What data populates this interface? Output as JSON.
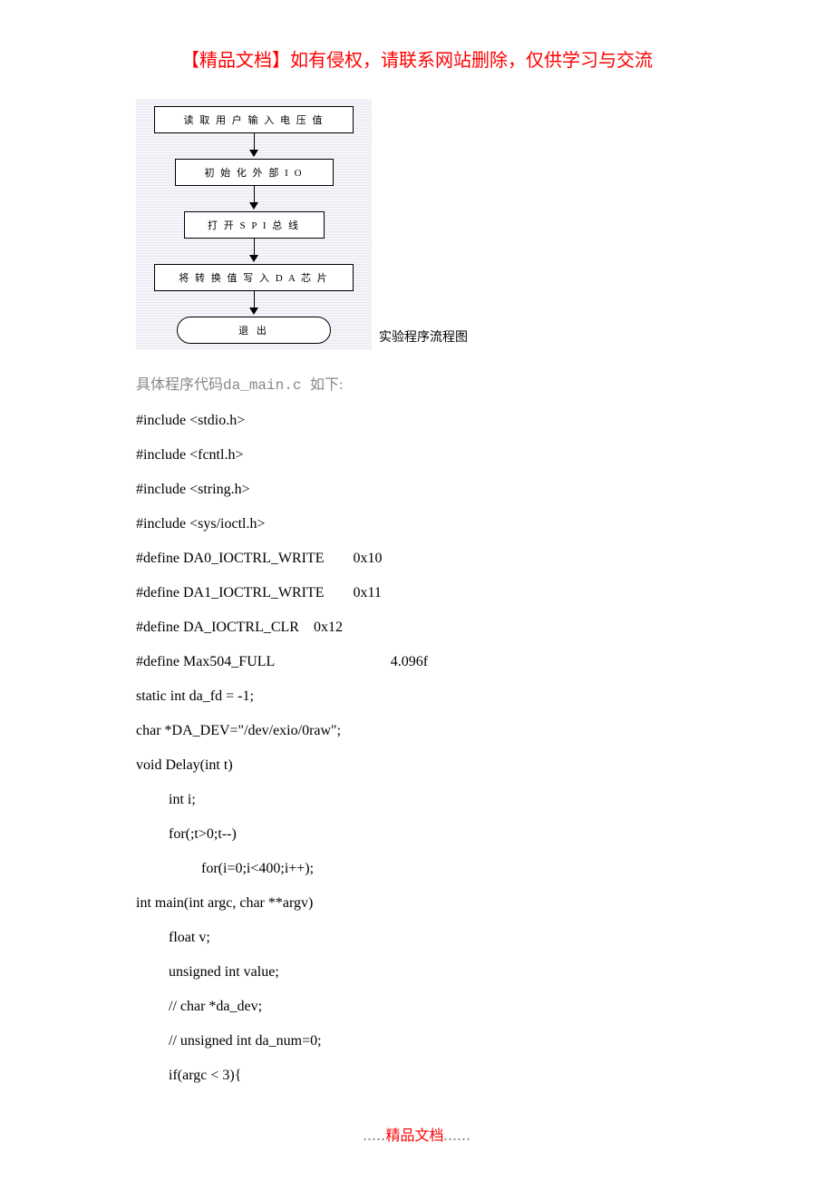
{
  "header": "【精品文档】如有侵权，请联系网站删除，仅供学习与交流",
  "flowchart": {
    "step1": "读 取 用 户 输 入 电 压 值",
    "step2": "初 始 化 外 部 I O",
    "step3": "打 开 S P I 总 线",
    "step4": "将 转 换 值 写 入 D A 芯 片",
    "end": "退 出",
    "caption": "实验程序流程图"
  },
  "section": {
    "label_pre": "具体程序代码",
    "label_file": "da_main.c ",
    "label_post": "如下:"
  },
  "code": {
    "l1": "#include <stdio.h>",
    "l2": "#include <fcntl.h>",
    "l3": "#include <string.h>",
    "l4": "#include <sys/ioctl.h>",
    "l5": "#define DA0_IOCTRL_WRITE        0x10",
    "l6": "#define DA1_IOCTRL_WRITE        0x11",
    "l7": "#define DA_IOCTRL_CLR    0x12",
    "l8": "#define Max504_FULL                                4.096f",
    "l9": "static int da_fd = -1;",
    "l10": "char *DA_DEV=\"/dev/exio/0raw\";",
    "l11": "void Delay(int t)",
    "l12": "int i;",
    "l13": "for(;t>0;t--)",
    "l14": "for(i=0;i<400;i++);",
    "l15": "int main(int argc, char **argv)",
    "l16": "float v;",
    "l17": "unsigned int value;",
    "l18": "// char *da_dev;",
    "l19": "// unsigned int da_num=0;",
    "l20": "if(argc < 3){"
  },
  "footer": {
    "dots_left": ".....",
    "mid": "精品文档",
    "dots_right": "......"
  }
}
